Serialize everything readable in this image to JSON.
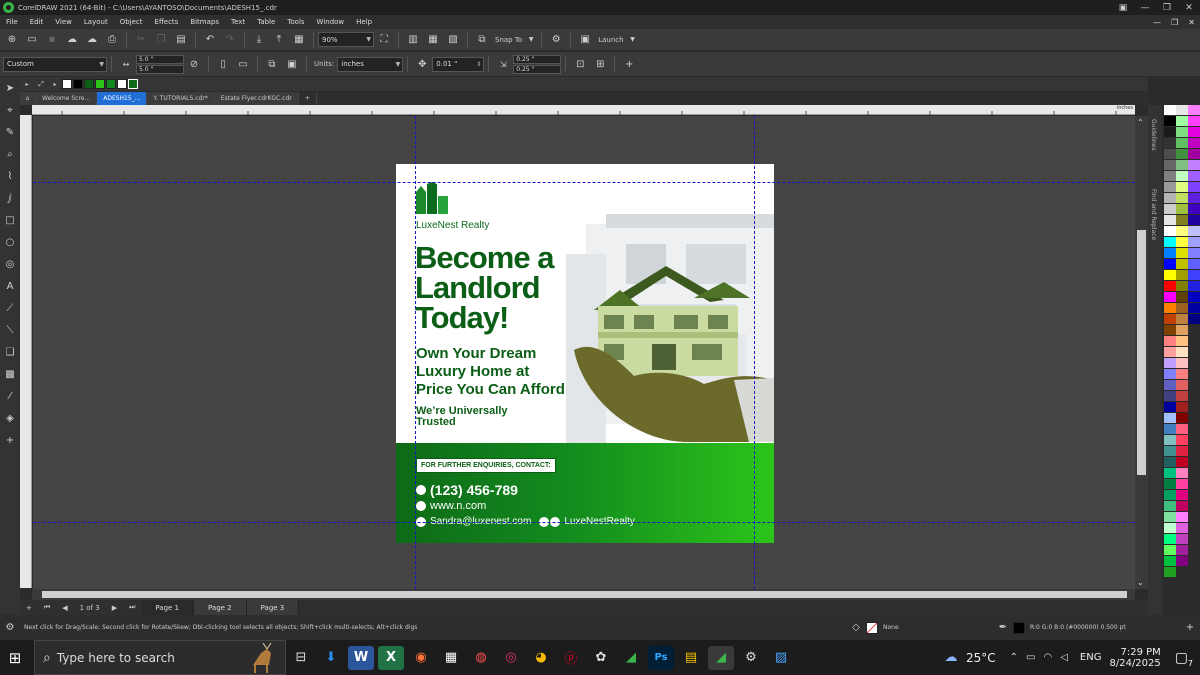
{
  "window": {
    "title": "CorelDRAW 2021 (64-Bit) - C:\\Users\\AYANTOSO\\Documents\\ADESH15_.cdr",
    "controls": [
      "—",
      "❐",
      "✕"
    ]
  },
  "menu": [
    "File",
    "Edit",
    "View",
    "Layout",
    "Object",
    "Effects",
    "Bitmaps",
    "Text",
    "Table",
    "Tools",
    "Window",
    "Help"
  ],
  "toolbar": {
    "zoom": "90%",
    "snap_to": "Snap To",
    "launch": "Launch"
  },
  "property_bar": {
    "preset": "Custom",
    "width": "5.0 \"",
    "height": "5.0 \"",
    "units_label": "Units:",
    "units_value": "inches",
    "nudge": "0.01 \"",
    "dup_x": "0.25 \"",
    "dup_y": "0.25 \""
  },
  "tabs": [
    "Welcome Scre...",
    "ADESH15_...",
    "Y. TUTORIALS.cdr*",
    "Estate Flyer.cdrKGC.cdr"
  ],
  "ruler_unit": "inches",
  "docker_labels": [
    "Guidelines",
    "Find and Replace"
  ],
  "pages": {
    "count": "1 of 3",
    "tabs": [
      "Page 1",
      "Page 2",
      "Page 3"
    ]
  },
  "status": {
    "hint": "Next click for Drag/Scale; Second click for Rotate/Skew; Dbl-clicking tool selects all objects; Shift+click multi-selects; Alt+click digs",
    "fill": "None",
    "outline": "R:0 G:0 B:0 (#000000)  0.500 pt"
  },
  "taskbar": {
    "search_placeholder": "Type here to search",
    "weather": "25°C",
    "lang": "ENG",
    "time": "7:29 PM",
    "date": "8/24/2025",
    "notif_count": "7"
  },
  "flyer": {
    "brand": "LuxeNest Realty",
    "headline": [
      "Become a",
      "Landlord",
      "Today!"
    ],
    "subline": [
      "Own Your Dream",
      "Luxury Home at",
      "Price You Can Afford"
    ],
    "trust": [
      "We’re Universally",
      "Trusted"
    ],
    "enquiry": "FOR FURTHER ENQUIRIES, CONTACT:",
    "phone": "(123) 456-789",
    "website": "www.n.com",
    "email": "Sandra@luxenest.com",
    "social": "LuxeNestRealty"
  },
  "colors": {
    "brand_green": "#0b5e16",
    "band_start": "#0e6a17",
    "band_end": "#2cc51a",
    "guideline": "#1818c8",
    "active_tab": "#1f6fd6"
  },
  "palette_swatches": [
    [
      "#ffffff",
      "#000000",
      "#1a1a1a",
      "#333333",
      "#4d4d4d",
      "#666666",
      "#808080",
      "#999999",
      "#b3b3b3",
      "#cccccc",
      "#e6e6e6",
      "#ffffff",
      "#00ffff",
      "#0080ff",
      "#0000ff",
      "#ffff00",
      "#ff0000",
      "#ff00ff",
      "#ff8000",
      "#c04000",
      "#804000",
      "#ff8080",
      "#ffa0a0",
      "#c0a0ff",
      "#8080ff",
      "#6060c0",
      "#404080",
      "#0000a0",
      "#a0c0ff",
      "#4080c0",
      "#80c0c0",
      "#409090",
      "#206060",
      "#00c080",
      "#008040",
      "#00a060",
      "#40c080",
      "#80e0a0",
      "#c0ffd0",
      "#00ff80",
      "#60ff60",
      "#00c040",
      "#20a020"
    ],
    [
      "#e6e6e6",
      "#a0ffa0",
      "#80e080",
      "#60c060",
      "#409040",
      "#80c080",
      "#c0ffc0",
      "#e0ff80",
      "#c0e060",
      "#a0c040",
      "#808020",
      "#ffff80",
      "#ffff40",
      "#e0e000",
      "#c0c000",
      "#a0a000",
      "#808000",
      "#604000",
      "#a06020",
      "#c08040",
      "#e0a060",
      "#ffc080",
      "#ffe0c0",
      "#ffc0c0",
      "#ff8080",
      "#e06060",
      "#c04040",
      "#a02020",
      "#800000",
      "#ff6080",
      "#ff4060",
      "#e02040",
      "#c00020",
      "#ff80c0",
      "#ff40a0",
      "#e00080",
      "#c00060",
      "#ff80ff",
      "#e060e0",
      "#c040c0",
      "#a020a0",
      "#800080"
    ],
    [
      "#ff80ff",
      "#ff40ff",
      "#e000e0",
      "#c000c0",
      "#a000a0",
      "#c080ff",
      "#a060ff",
      "#8040ff",
      "#6020e0",
      "#4000c0",
      "#2000a0",
      "#c0c0ff",
      "#a0a0ff",
      "#8080ff",
      "#6060ff",
      "#4040ff",
      "#2020e0",
      "#0000c0",
      "#0000a0",
      "#000080"
    ]
  ],
  "toolbar_icons": [
    "new-icon",
    "open-icon",
    "save-icon",
    "cloud-upload-icon",
    "cloud-download-icon",
    "print-icon",
    "import-icon",
    "export-icon",
    "export-pdf-icon",
    "undo-icon",
    "redo-icon"
  ],
  "toolbox_icons": [
    "pick-tool-icon",
    "shape-tool-icon",
    "crop-tool-icon",
    "zoom-tool-icon",
    "freehand-tool-icon",
    "artistic-media-icon",
    "rectangle-tool-icon",
    "ellipse-tool-icon",
    "polygon-tool-icon",
    "text-tool-icon",
    "parallel-dimension-icon",
    "connector-tool-icon",
    "drop-shadow-icon",
    "transparency-icon",
    "eyedropper-icon",
    "interactive-fill-icon",
    "add-tool-icon"
  ]
}
